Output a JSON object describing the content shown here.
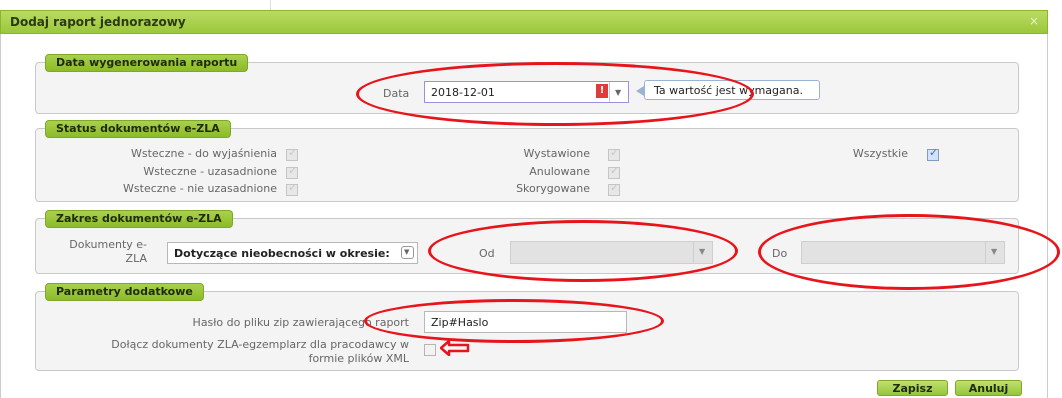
{
  "dialog": {
    "title": "Dodaj raport jednorazowy",
    "close": "×"
  },
  "sections": {
    "date": {
      "legend": "Data wygenerowania raportu",
      "label": "Data",
      "value": "2018-12-01",
      "error_badge": "!",
      "tooltip": "Ta wartość jest wymagana."
    },
    "status": {
      "legend": "Status dokumentów e-ZLA",
      "col1": [
        "Wsteczne - do wyjaśnienia",
        "Wsteczne - uzasadnione",
        "Wsteczne - nie uzasadnione"
      ],
      "col2": [
        "Wystawione",
        "Anulowane",
        "Skorygowane"
      ],
      "all_label": "Wszystkie"
    },
    "range": {
      "legend": "Zakres dokumentów e-ZLA",
      "docs_label_1": "Dokumenty e-",
      "docs_label_2": "ZLA",
      "select_value": "Dotyczące nieobecności w okresie:",
      "from_label": "Od",
      "to_label": "Do"
    },
    "params": {
      "legend": "Parametry dodatkowe",
      "zip_label": "Hasło do pliku zip zawierającego raport",
      "zip_value": "Zip#Haslo",
      "attach_label_1": "Dołącz dokumenty ZLA-egzemplarz dla pracodawcy w",
      "attach_label_2": "formie plików XML"
    }
  },
  "buttons": {
    "save": "Zapisz",
    "cancel": "Anuluj"
  },
  "colors": {
    "accent_green": "#9cc83a",
    "annotation_red": "#e8141b",
    "error_red": "#e03a3a"
  }
}
